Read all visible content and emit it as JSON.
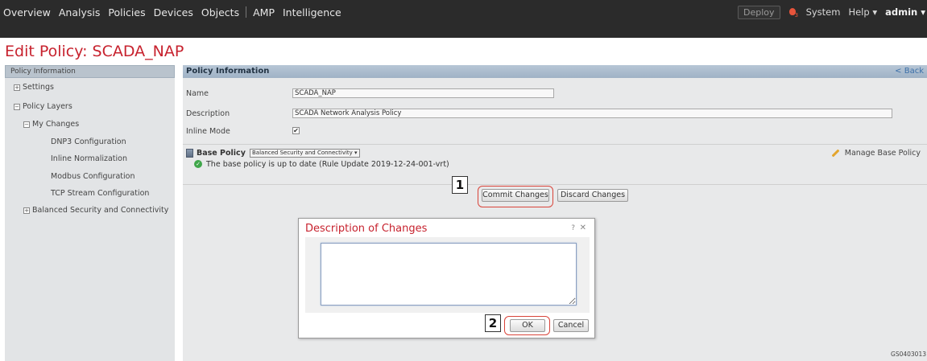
{
  "nav": {
    "items": [
      "Overview",
      "Analysis",
      "Policies",
      "Devices",
      "Objects",
      "AMP",
      "Intelligence"
    ],
    "deploy": "Deploy",
    "alert_count": "3",
    "system": "System",
    "help": "Help ▾",
    "user": "admin ▾"
  },
  "page": {
    "title": "Edit Policy: SCADA_NAP"
  },
  "sidebar": {
    "header": "Policy Information",
    "items": [
      {
        "label": "Settings",
        "toggle": "+"
      },
      {
        "label": "Policy Layers",
        "toggle": "−"
      },
      {
        "label": "My Changes",
        "toggle": "−"
      },
      {
        "label": "DNP3 Configuration"
      },
      {
        "label": "Inline Normalization"
      },
      {
        "label": "Modbus Configuration"
      },
      {
        "label": "TCP Stream Configuration"
      },
      {
        "label": "Balanced Security and Connectivity",
        "toggle": "+"
      }
    ]
  },
  "panel": {
    "title": "Policy Information",
    "back": "< Back",
    "name_label": "Name",
    "name_value": "SCADA_NAP",
    "desc_label": "Description",
    "desc_value": "SCADA Network Analysis Policy",
    "inline_label": "Inline Mode",
    "inline_checked": "✔",
    "base_policy_label": "Base Policy",
    "base_policy_value": "Balanced Security and Connectivity ▾",
    "uptodate": "The base policy is up to date (Rule Update 2019-12-24-001-vrt)",
    "manage": "Manage Base Policy",
    "commit": "Commit Changes",
    "discard": "Discard Changes"
  },
  "dialog": {
    "title": "Description of Changes",
    "help": "?",
    "close": "✕",
    "ok": "OK",
    "cancel": "Cancel"
  },
  "callouts": {
    "one": "1",
    "two": "2"
  },
  "watermark": "GS0403013",
  "colors": {
    "accent": "#c7222e",
    "topbar": "#2b2b2b",
    "highlight": "#d9443a"
  }
}
